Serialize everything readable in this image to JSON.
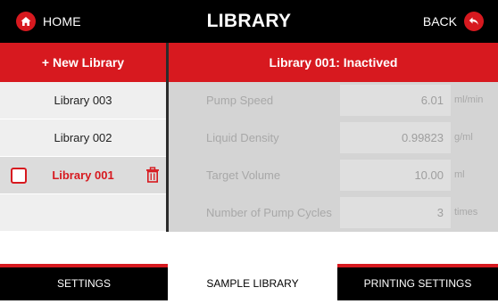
{
  "header": {
    "home_label": "HOME",
    "title": "LIBRARY",
    "back_label": "BACK"
  },
  "actions": {
    "new_library_label": "+ New Library"
  },
  "detail": {
    "title": "Library 001: Inactived"
  },
  "libraries": [
    {
      "label": "Library 003",
      "selected": false
    },
    {
      "label": "Library 002",
      "selected": false
    },
    {
      "label": "Library 001",
      "selected": true
    }
  ],
  "params": [
    {
      "name": "Pump Speed",
      "value": "6.01",
      "unit": "ml/min"
    },
    {
      "name": "Liquid Density",
      "value": "0.99823",
      "unit": "g/ml"
    },
    {
      "name": "Target Volume",
      "value": "10.00",
      "unit": "ml"
    },
    {
      "name": "Number of Pump Cycles",
      "value": "3",
      "unit": "times"
    }
  ],
  "tabs": [
    {
      "label": "SETTINGS",
      "active": false
    },
    {
      "label": "SAMPLE LIBRARY",
      "active": true
    },
    {
      "label": "PRINTING SETTINGS",
      "active": false
    }
  ],
  "colors": {
    "accent": "#d7191f",
    "header_bg": "#000000",
    "panel_bg": "#d4d4d4",
    "list_bg": "#efefef"
  },
  "icons": {
    "home": "home-icon",
    "back": "back-arrow-icon",
    "trash": "trash-icon",
    "checkbox": "checkbox-icon"
  }
}
